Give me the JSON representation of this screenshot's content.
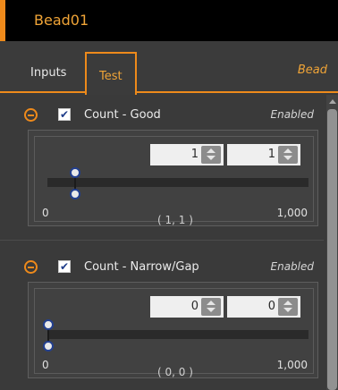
{
  "window": {
    "title": "Bead01"
  },
  "tabs": [
    {
      "label": "Inputs",
      "active": false
    },
    {
      "label": "Test",
      "active": true
    }
  ],
  "tab_bar": {
    "tool_label": "Bead"
  },
  "sections": [
    {
      "label": "Count - Good",
      "checked": true,
      "status": "Enabled",
      "min_value": "1",
      "max_value": "1",
      "separator": "-",
      "range_min": "0",
      "range_max": "1,000",
      "current_range": "( 1, 1 )"
    },
    {
      "label": "Count - Narrow/Gap",
      "checked": true,
      "status": "Enabled",
      "min_value": "0",
      "max_value": "0",
      "separator": "-",
      "range_min": "0",
      "range_max": "1,000",
      "current_range": "( 0, 0 )"
    }
  ],
  "icons": {
    "collapse": "minus-circle-icon",
    "spin": "spinner-arrows-icon",
    "scroll_up": "scroll-up-arrow-icon"
  },
  "colors": {
    "accent": "#ee8a1b",
    "accent_text": "#f0a437",
    "background": "#3a3a3a",
    "panel": "#414141",
    "title_bg": "#000000",
    "knob_border": "#223f8f"
  }
}
